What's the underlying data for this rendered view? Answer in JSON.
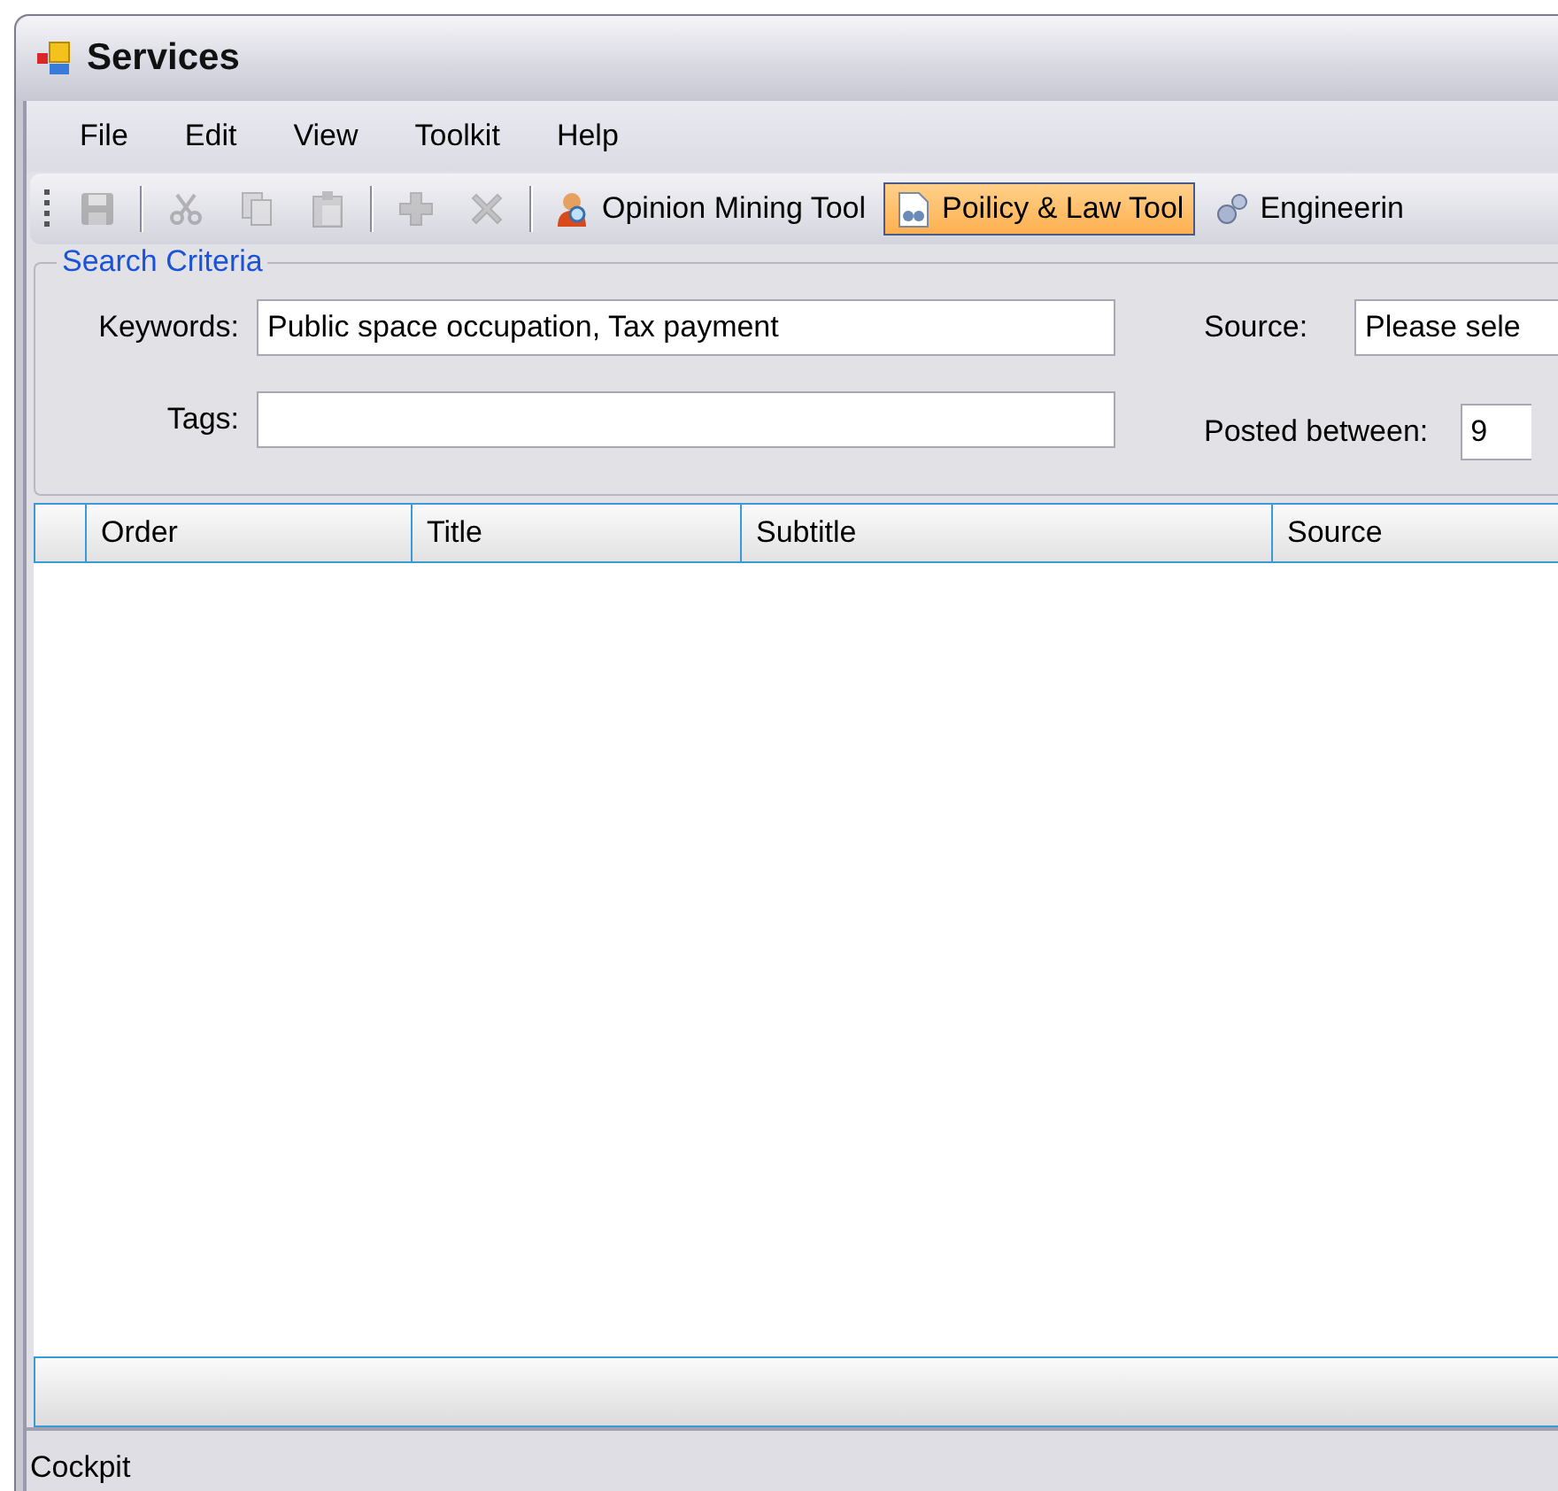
{
  "window": {
    "title": "Services"
  },
  "menu": [
    "File",
    "Edit",
    "View",
    "Toolkit",
    "Help"
  ],
  "toolbar": {
    "icon_buttons": [
      {
        "disabled": true
      },
      {
        "disabled": true
      },
      {
        "disabled": true
      },
      {
        "disabled": true
      },
      {
        "disabled": true
      },
      {
        "disabled": true
      }
    ],
    "tools": [
      {
        "label": "Opinion Mining Tool",
        "selected": false
      },
      {
        "label": "Poilicy & Law Tool",
        "selected": true
      },
      {
        "label": "Engineerin",
        "selected": false
      }
    ]
  },
  "search_criteria": {
    "title": "Search Criteria",
    "keywords_label": "Keywords:",
    "keywords_value": "Public space occupation, Tax payment",
    "tags_label": "Tags:",
    "source_label": "Source:",
    "source_value": "Please sele",
    "posted_label": "Posted between:",
    "posted_value": "9"
  },
  "table": {
    "columns": [
      "Order",
      "Title",
      "Subtitle",
      "Source"
    ]
  },
  "status_bar": "Cockpit"
}
